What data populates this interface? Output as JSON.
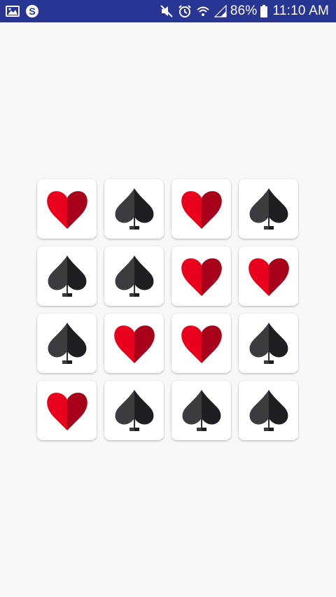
{
  "status_bar": {
    "left_icons": [
      "image-icon",
      "skype-icon"
    ],
    "right_icons": [
      "mute-icon",
      "alarm-icon",
      "wifi-icon",
      "signal-icon"
    ],
    "battery_text": "86%",
    "battery_icon": "battery-icon",
    "time": "11:10 AM",
    "background_color": "#283593"
  },
  "board": {
    "rows": 4,
    "columns": 4,
    "cards": [
      {
        "suit": "heart"
      },
      {
        "suit": "spade"
      },
      {
        "suit": "heart"
      },
      {
        "suit": "spade"
      },
      {
        "suit": "spade"
      },
      {
        "suit": "spade"
      },
      {
        "suit": "heart"
      },
      {
        "suit": "heart"
      },
      {
        "suit": "spade"
      },
      {
        "suit": "heart"
      },
      {
        "suit": "heart"
      },
      {
        "suit": "spade"
      },
      {
        "suit": "heart"
      },
      {
        "suit": "spade"
      },
      {
        "suit": "spade"
      },
      {
        "suit": "spade"
      }
    ],
    "colors": {
      "heart_light": "#e8001d",
      "heart_dark": "#a8001a",
      "spade_light": "#3c3c40",
      "spade_dark": "#1e1e22"
    }
  }
}
